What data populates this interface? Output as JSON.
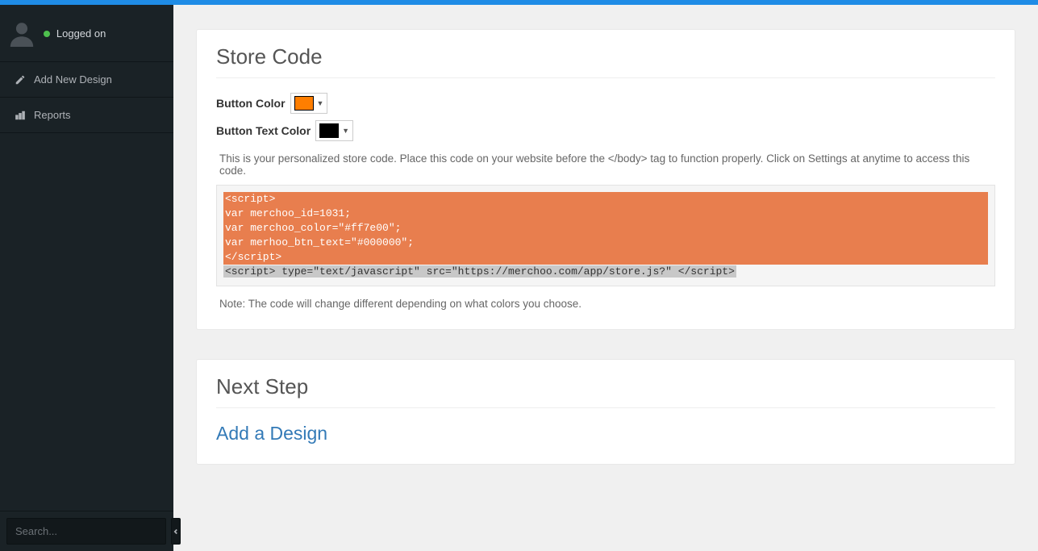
{
  "sidebar": {
    "status": "Logged on",
    "nav": [
      {
        "label": "Add New Design"
      },
      {
        "label": "Reports"
      }
    ],
    "search_placeholder": "Search..."
  },
  "store_code": {
    "title": "Store Code",
    "button_color_label": "Button Color",
    "button_text_color_label": "Button Text Color",
    "button_color_value": "#ff7e00",
    "button_text_color_value": "#000000",
    "instruction": "This is your personalized store code. Place this code on your website before the </body> tag to function properly. Click on Settings at anytime to access this code.",
    "code_block_main": "<script>\nvar merchoo_id=1031;\nvar merchoo_color=\"#ff7e00\";\nvar merhoo_btn_text=\"#000000\";\n</script>",
    "code_block_tail": "<script> type=\"text/javascript\" src=\"https://merchoo.com/app/store.js?\" </script>",
    "note": "Note: The code will change different depending on what colors you choose."
  },
  "next_step": {
    "title": "Next Step",
    "link": "Add a Design"
  }
}
